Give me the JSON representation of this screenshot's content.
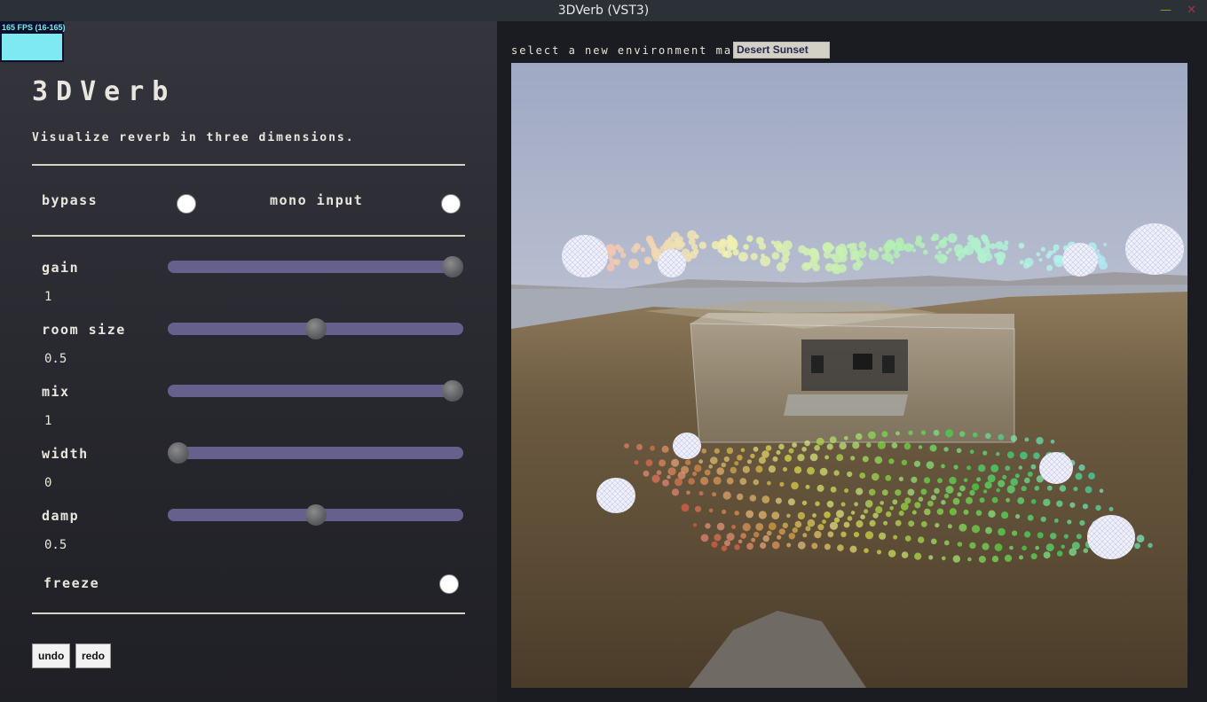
{
  "window": {
    "title": "3DVerb (VST3)",
    "minimize_glyph": "—",
    "close_glyph": "✕"
  },
  "fps": {
    "label": "165 FPS (16-165)"
  },
  "plugin": {
    "title": "3DVerb",
    "tagline": "Visualize reverb in three dimensions.",
    "toggles": {
      "bypass": "bypass",
      "mono_input": "mono input",
      "freeze": "freeze"
    },
    "params": [
      {
        "label": "gain",
        "value": "1",
        "level": 1.0
      },
      {
        "label": "room size",
        "value": "0.5",
        "level": 0.5
      },
      {
        "label": "mix",
        "value": "1",
        "level": 1.0
      },
      {
        "label": "width",
        "value": "0",
        "level": 0.0
      },
      {
        "label": "damp",
        "value": "0.5",
        "level": 0.5
      }
    ],
    "buttons": {
      "undo": "undo",
      "redo": "redo"
    }
  },
  "environment": {
    "label": "select a new environment map:",
    "selected": "Desert Sunset"
  },
  "colors": {
    "slider_track": "#65618c",
    "accent_fps": "#7fe9f1",
    "panel_text": "#e9e6df"
  }
}
